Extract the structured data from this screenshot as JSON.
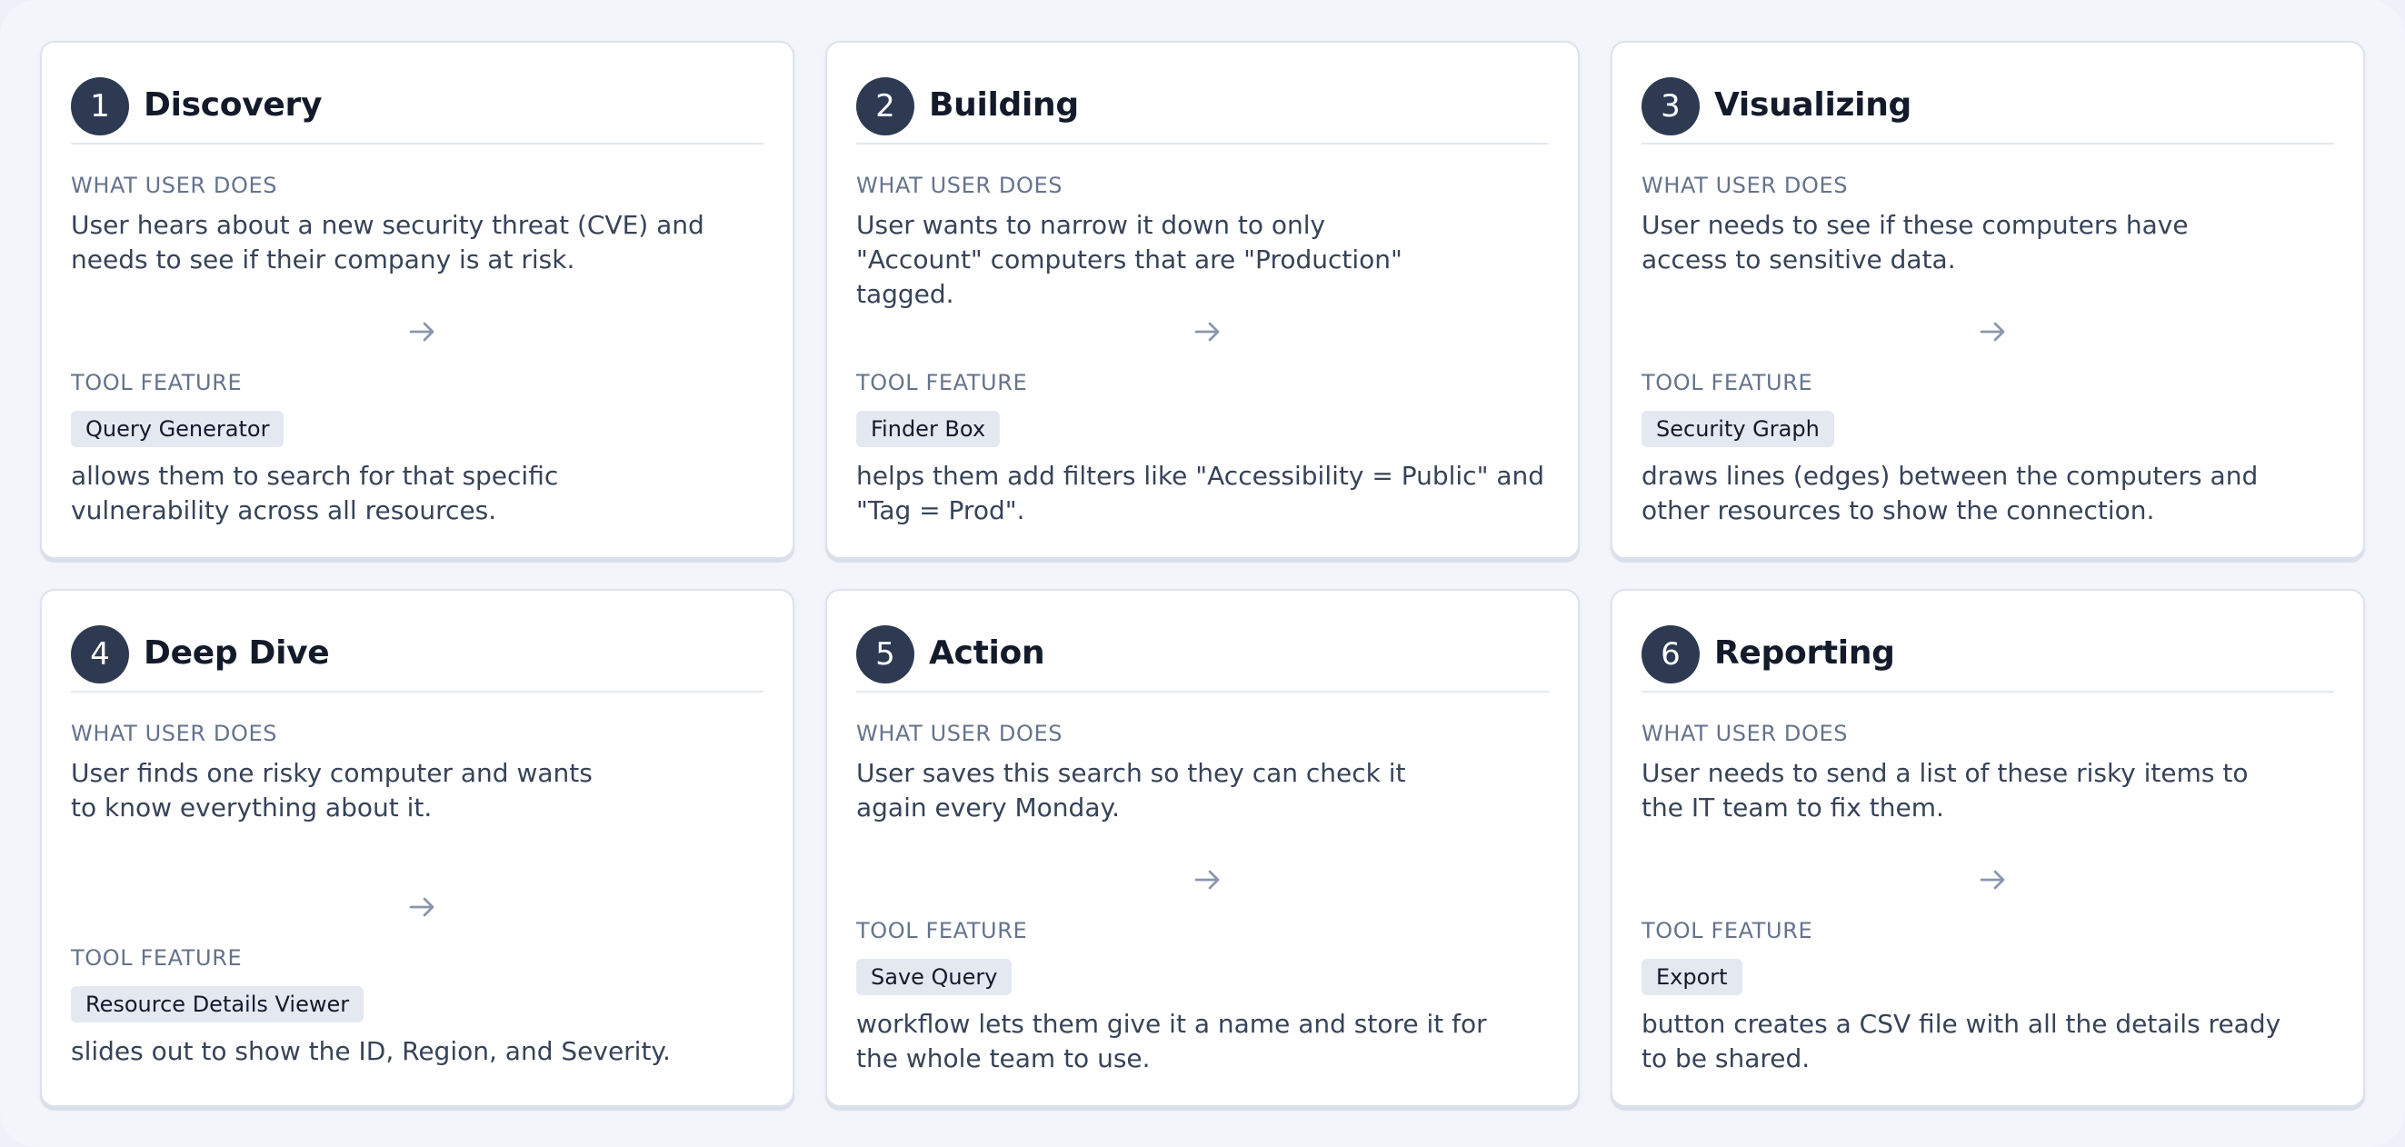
{
  "labels": {
    "what_user_does": "WHAT USER DOES",
    "tool_feature": "TOOL FEATURE"
  },
  "icons": {
    "arrow": "arrow-right-icon"
  },
  "colors": {
    "badge": "#2d3a52",
    "chip": "#e4e8f1",
    "background": "#f3f5fb"
  },
  "steps": [
    {
      "number": "1",
      "title": "Discovery",
      "user_action": "User hears about a new security threat (CVE) and needs to see if their company is at risk.",
      "feature": "Query Generator",
      "feature_desc": "allows them to search for that specific vulnerability across all resources."
    },
    {
      "number": "2",
      "title": "Building",
      "user_action": "User wants to narrow it down to only \"Account\" computers that are \"Production\" tagged.",
      "feature": "Finder Box",
      "feature_desc": "helps them add filters like \"Accessibility = Public\" and \"Tag = Prod\"."
    },
    {
      "number": "3",
      "title": "Visualizing",
      "user_action": "User needs to see if these computers have access to sensitive data.",
      "feature": "Security Graph",
      "feature_desc": "draws lines (edges) between the computers and other resources to show the connection."
    },
    {
      "number": "4",
      "title": "Deep Dive",
      "user_action": "User finds one risky computer and wants to know everything about it.",
      "feature": "Resource Details Viewer",
      "feature_desc": "slides out to show the ID, Region, and Severity."
    },
    {
      "number": "5",
      "title": "Action",
      "user_action": "User saves this search so they can check it again every Monday.",
      "feature": "Save Query",
      "feature_desc": "workflow lets them give it a name and store it for the whole team to use."
    },
    {
      "number": "6",
      "title": "Reporting",
      "user_action": "User needs to send a list of these risky items to the IT team to fix them.",
      "feature": "Export",
      "feature_desc": "button creates a CSV file with all the details ready to be shared."
    }
  ]
}
